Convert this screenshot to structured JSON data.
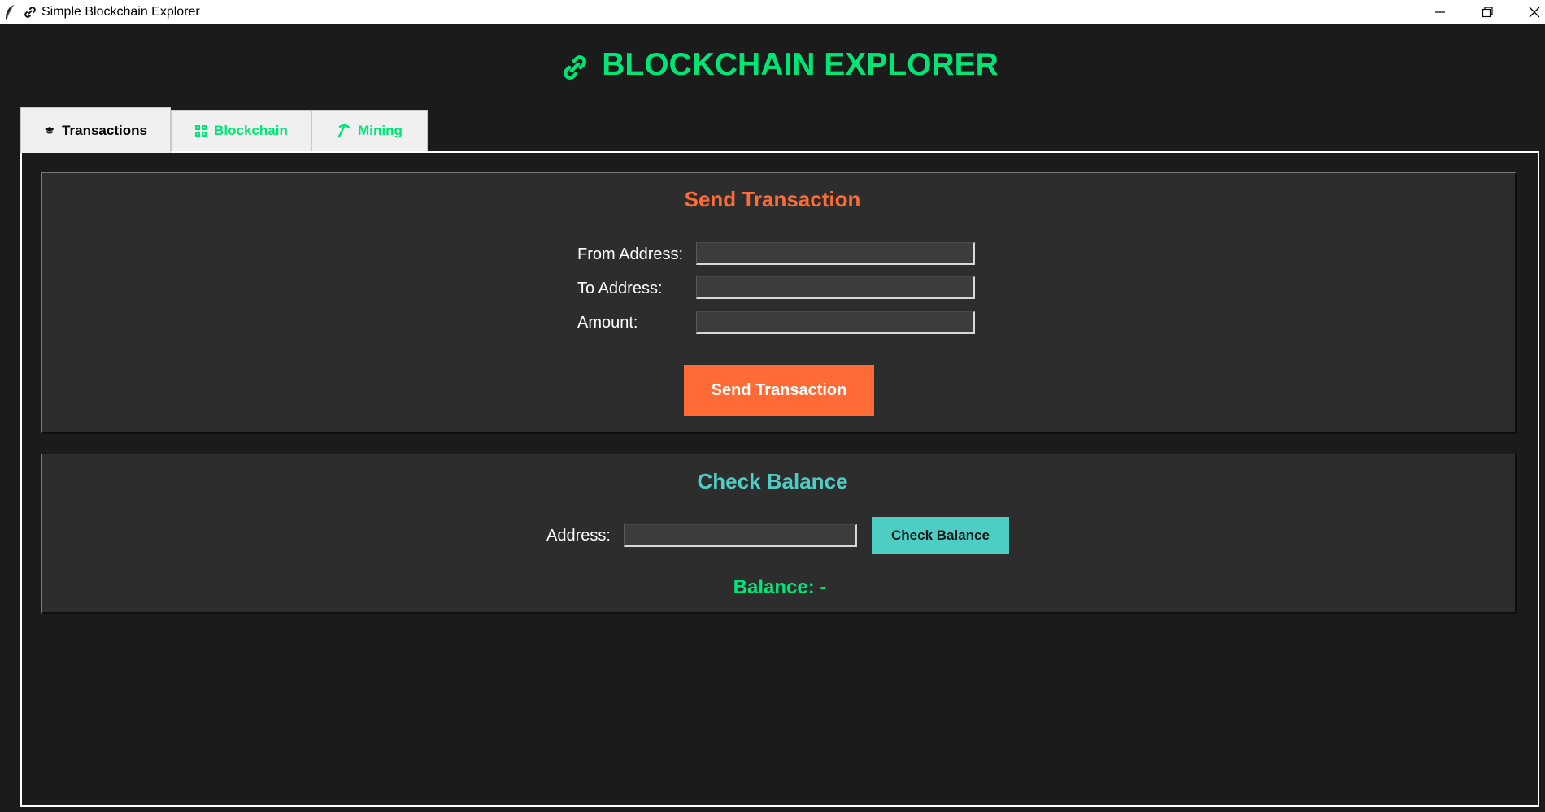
{
  "window": {
    "title": "Simple Blockchain Explorer"
  },
  "header": {
    "title": "BLOCKCHAIN EXPLORER",
    "icon": "link-icon",
    "color": "#00e676"
  },
  "tabs": [
    {
      "label": "Transactions",
      "icon": "graduation-cap-icon",
      "active": true
    },
    {
      "label": "Blockchain",
      "icon": "blocks-icon",
      "active": false
    },
    {
      "label": "Mining",
      "icon": "pickaxe-icon",
      "active": false
    }
  ],
  "send_section": {
    "title": "Send Transaction",
    "title_color": "#ff6b35",
    "fields": [
      {
        "label": "From Address:",
        "value": ""
      },
      {
        "label": "To Address:",
        "value": ""
      },
      {
        "label": "Amount:",
        "value": ""
      }
    ],
    "button_label": "Send Transaction"
  },
  "balance_section": {
    "title": "Check Balance",
    "title_color": "#4ecdc4",
    "address_label": "Address:",
    "address_value": "",
    "button_label": "Check Balance",
    "result": "Balance: -"
  }
}
